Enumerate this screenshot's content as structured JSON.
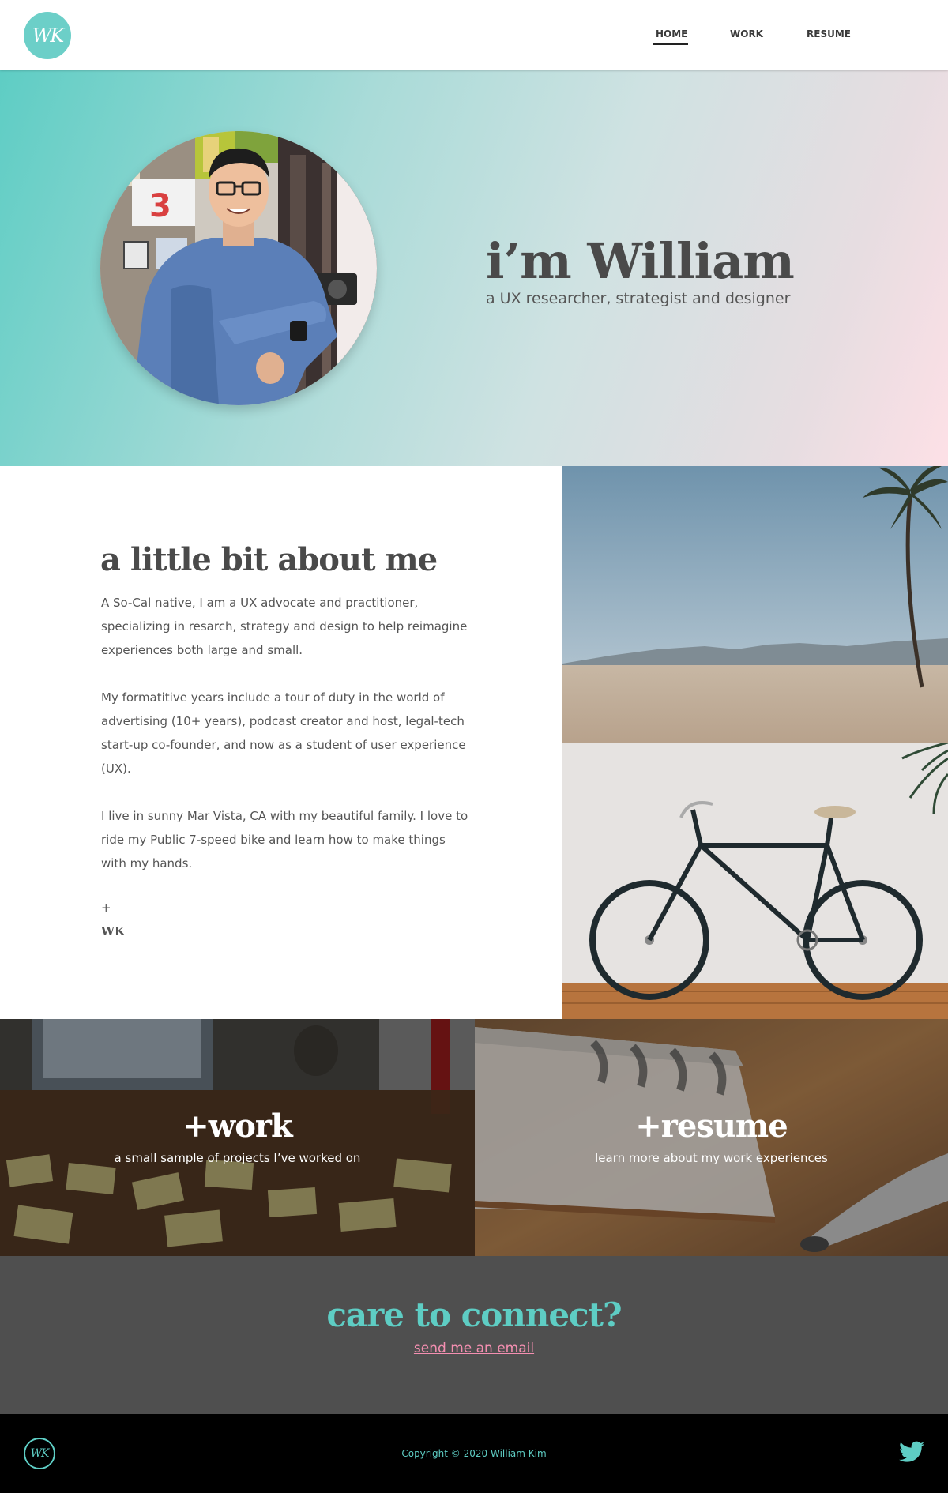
{
  "nav": {
    "logo_text": "WK",
    "links": [
      {
        "label": "HOME",
        "active": true
      },
      {
        "label": "WORK",
        "active": false
      },
      {
        "label": "RESUME",
        "active": false
      }
    ]
  },
  "hero": {
    "title": "i’m William",
    "subtitle": "a UX researcher, strategist and designer"
  },
  "about": {
    "title": "a little bit about me",
    "paragraphs": [
      "A So-Cal native, I am a UX advocate and practitioner, specializing in resarch, strategy and design to help reimagine experiences both large and small.",
      "My formatitive years include a tour of duty in the world of advertising (10+ years), podcast creator and host, legal-tech start-up co-founder, and now as a student of user experience (UX).",
      "I live in sunny Mar Vista, CA with my beautiful family. I love to ride my Public 7-speed bike and learn how to make things with my hands."
    ],
    "sign_plus": "+",
    "sign_initials": "WK"
  },
  "cards": [
    {
      "title": "+work",
      "subtitle": "a small sample of projects I’ve worked on"
    },
    {
      "title": "+resume",
      "subtitle": "learn more about my work experiences"
    }
  ],
  "connect": {
    "title": "care to connect?",
    "link": "send me an email"
  },
  "footer": {
    "logo_text": "WK",
    "copyright": "Copyright © 2020 William Kim",
    "social_icon": "twitter-icon"
  },
  "colors": {
    "accent": "#5ecdc4",
    "link_pink": "#f48fb1",
    "connect_bg": "#4f4f4f",
    "footer_bg": "#000000"
  }
}
